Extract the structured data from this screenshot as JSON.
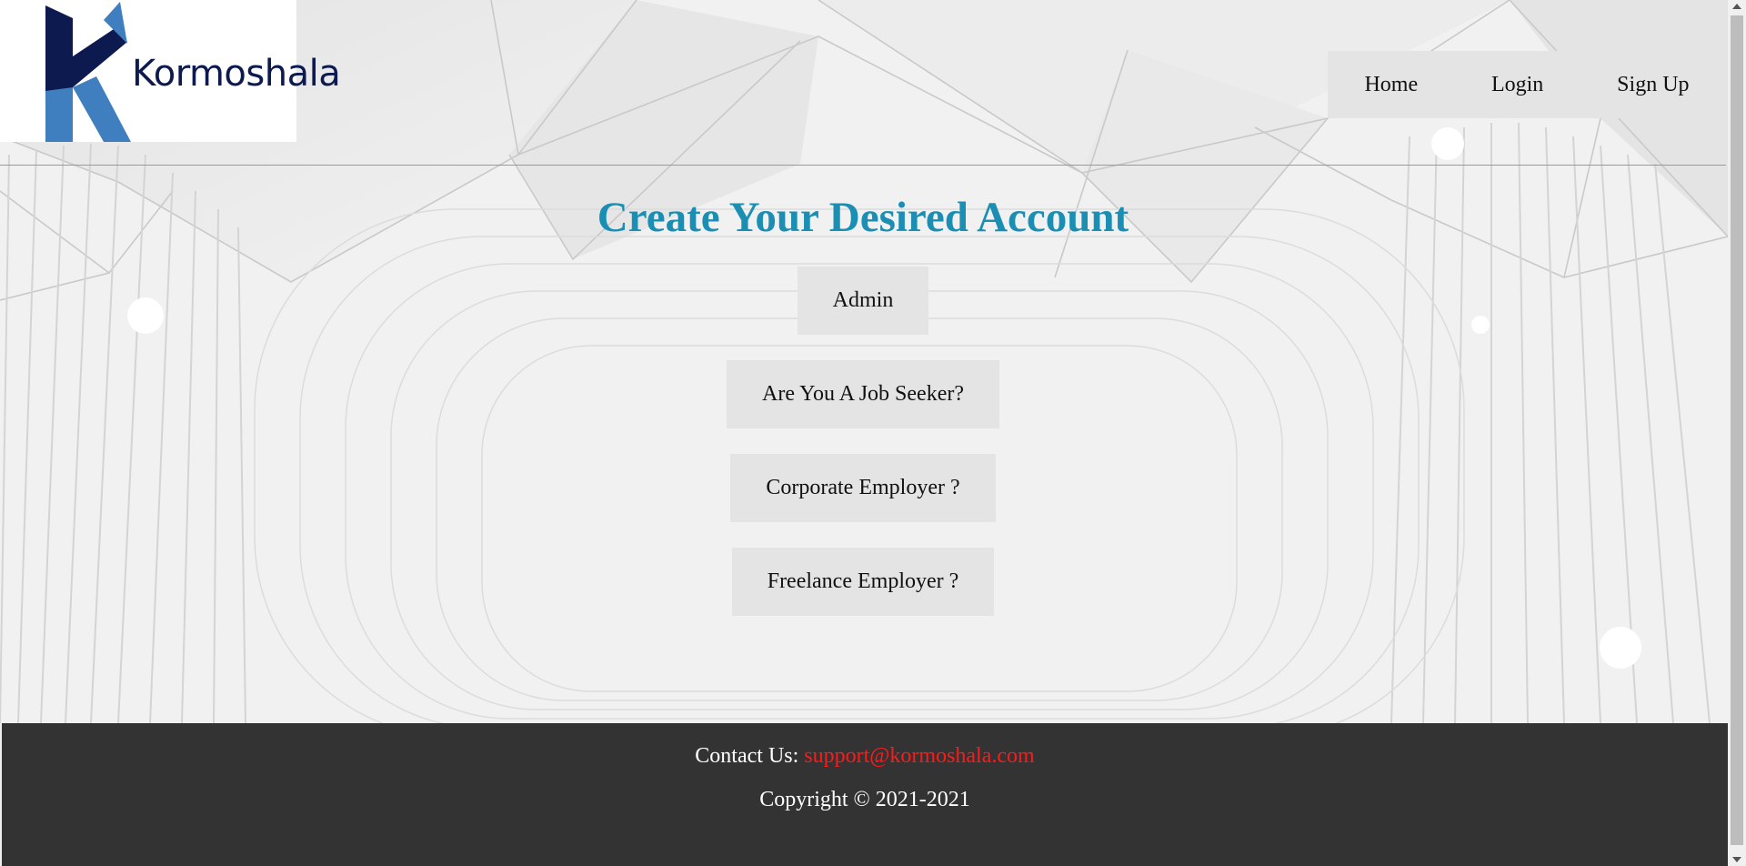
{
  "header": {
    "logo_text": "Kormoshala",
    "logo_icon": "k-arrow-logo-icon",
    "nav": [
      {
        "label": "Home"
      },
      {
        "label": "Login"
      },
      {
        "label": "Sign Up"
      }
    ]
  },
  "main": {
    "title": "Create Your Desired Account",
    "buttons": [
      {
        "label": "Admin"
      },
      {
        "label": "Are You A Job Seeker?"
      },
      {
        "label": "Corporate Employer ?"
      },
      {
        "label": "Freelance Employer ?"
      }
    ]
  },
  "footer": {
    "contact_label": "Contact Us:",
    "contact_email": "support@kormoshala.com",
    "copyright": "Copyright © 2021-2021"
  },
  "colors": {
    "title": "#1a8fb3",
    "email": "#ff1a1a",
    "footer_bg": "#333333",
    "logo_dark": "#0d1a4f",
    "logo_light": "#3f7fbf"
  }
}
